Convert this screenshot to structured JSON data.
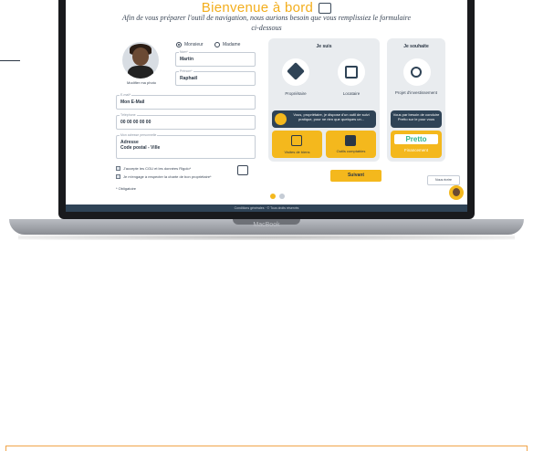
{
  "screen": {
    "title": "Bienvenue à bord",
    "subtitle": "Afin de vous préparer l'outil de navigation, nous aurions besoin que vous remplissiez le formulaire ci-dessous",
    "photo_label": "Modifier ma photo",
    "civility": {
      "option1": "Monsieur",
      "option2": "Madame",
      "selected": "Monsieur"
    },
    "fields": {
      "nom": {
        "label": "Nom*",
        "value": "Martin"
      },
      "prenom": {
        "label": "Prénom*",
        "value": "Raphaël"
      },
      "email": {
        "label": "E-mail*",
        "value": "Mon E-Mail"
      },
      "telephone": {
        "label": "Téléphone",
        "value": "00 00 00 00 00"
      },
      "adresse": {
        "label": "Mon adresse personnelle",
        "value": "Adresse\nCode postal - Ville"
      }
    },
    "checkboxes": [
      {
        "label": "J'accepte les CGU et les données Rigolo*"
      },
      {
        "label": "Je m'engage à respecter la charte de bon propriétaire*"
      }
    ],
    "required_note": "* Obligatoire",
    "panel_je_suis": {
      "title": "Je suis",
      "option1": "Propriétaire",
      "option2": "Locataire",
      "banner": "Vous, propriétaire, je dispose d'un outil de suivi pratique, pour ne rien que quelques un...",
      "card1": "Visites de biens",
      "card2": "Outils comptables"
    },
    "panel_je_souhaite": {
      "title": "Je souhaite",
      "option": "Projet d'investissement",
      "banner": "Vous par besoin de conduire Pretto sur le pour vous",
      "brand": "Pretto",
      "card": "Financement"
    },
    "next_button": "Suivant",
    "small_button": "Nous écrire",
    "footer": "Conditions générales · © Tous droits réservés",
    "pagination": {
      "active": 1,
      "total": 2
    }
  },
  "laptop_brand": "MacBook",
  "colors": {
    "accent": "#f4b81d",
    "navy": "#2f4356"
  }
}
